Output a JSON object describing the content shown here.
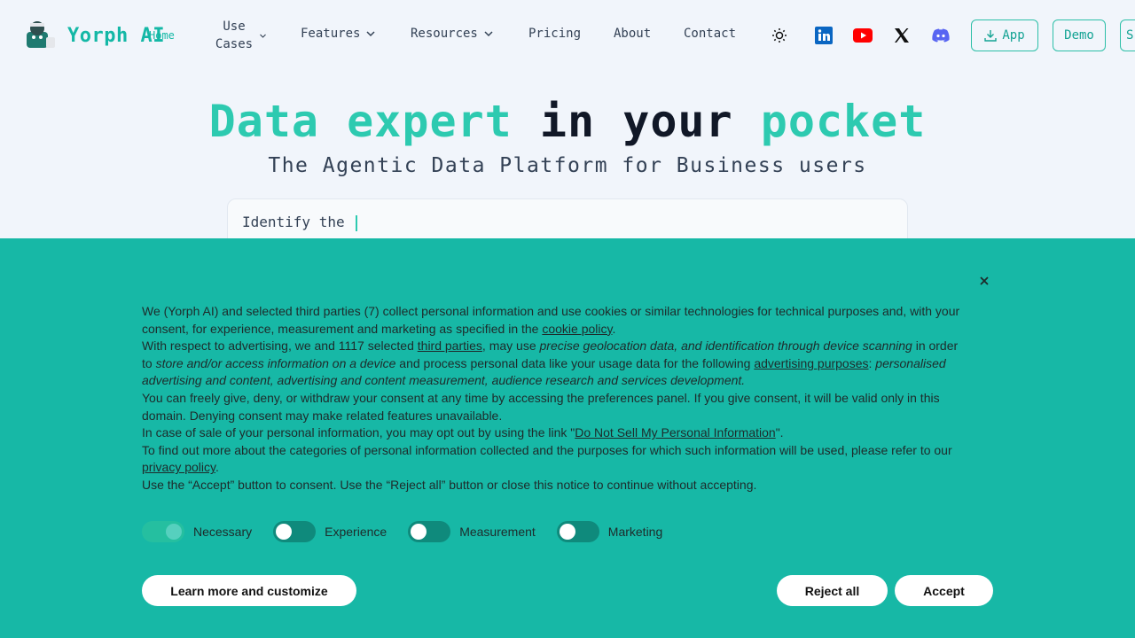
{
  "nav": {
    "logo_text": "Yorph AI",
    "home_label": "Home",
    "items": [
      {
        "label": "Use Cases"
      },
      {
        "label": "Features"
      },
      {
        "label": "Resources"
      },
      {
        "label": "Pricing"
      },
      {
        "label": "About"
      },
      {
        "label": "Contact"
      }
    ],
    "icons": [
      "sun-icon",
      "linkedin-icon",
      "youtube-icon",
      "x-icon",
      "discord-icon"
    ],
    "buttons": {
      "app": "App",
      "demo": "Demo",
      "signup_partial": "S"
    }
  },
  "hero": {
    "title_words": [
      "Data",
      "expert",
      "in",
      "your",
      "pocket"
    ],
    "subtitle": "The Agentic Data Platform for Business users",
    "prompt_text": "Identify the"
  },
  "cookie": {
    "p1": "We (Yorph AI) and selected third parties (7) collect personal information and use cookies or similar technologies for technical purposes and, with your consent, for experience, measurement and marketing as specified in the ",
    "p1_link": "cookie policy",
    "p2a": "With respect to advertising, we and 1117 selected ",
    "p2_link1": "third parties",
    "p2b": ", may use ",
    "p2_em1": "precise geolocation data, and identification through device scanning",
    "p2c": " in order to ",
    "p2_em2": "store and/or access information on a device",
    "p2d": " and process personal data like your usage data for the following ",
    "p2_link2": "advertising purposes",
    "p2e": ": ",
    "p2_em3": "personalised advertising and content, advertising and content measurement, audience research and services development.",
    "p3": "You can freely give, deny, or withdraw your consent at any time by accessing the preferences panel. If you give consent, it will be valid only in this domain. Denying consent may make related features unavailable.",
    "p4a": "In case of sale of your personal information, you may opt out by using the link \"",
    "p4_link": "Do Not Sell My Personal Information",
    "p4b": "\".",
    "p5a": "To find out more about the categories of personal information collected and the purposes for which such information will be used, please refer to our ",
    "p5_link": "privacy policy",
    "p6": "Use the “Accept” button to consent. Use the “Reject all” button or close this notice to continue without accepting.",
    "toggles": [
      {
        "label": "Necessary",
        "on": true
      },
      {
        "label": "Experience",
        "on": false
      },
      {
        "label": "Measurement",
        "on": false
      },
      {
        "label": "Marketing",
        "on": false
      }
    ],
    "btn_customize": "Learn more and customize",
    "btn_reject": "Reject all",
    "btn_accept": "Accept",
    "close_symbol": "×"
  },
  "colors": {
    "teal": "#2dcab0",
    "banner": "#17b8a6",
    "dark": "#111827"
  }
}
